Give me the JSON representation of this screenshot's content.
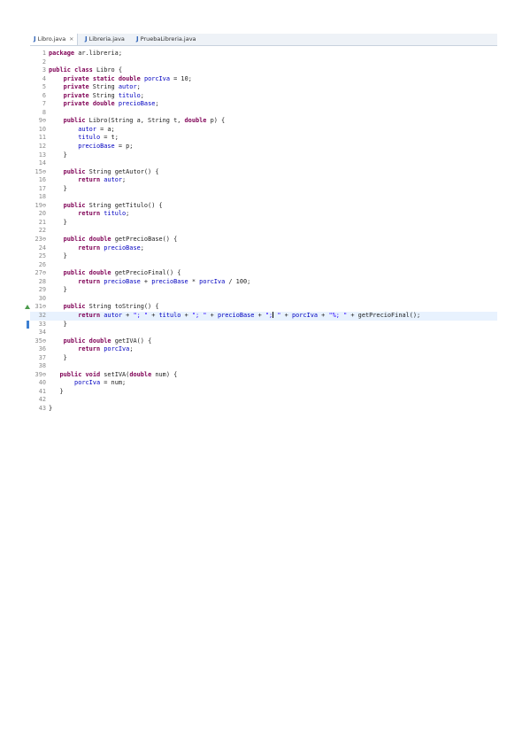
{
  "tabs": [
    {
      "label": "Libro.java",
      "icon": "java-file-icon",
      "active": true
    },
    {
      "label": "Libreria.java",
      "icon": "java-file-icon",
      "active": false
    },
    {
      "label": "PruebaLibreria.java",
      "icon": "java-file-icon",
      "active": false
    }
  ],
  "tab_close": "✕",
  "code": {
    "l1": {
      "num": "1",
      "kw": "package",
      "rest": " ar.libreria;"
    },
    "l2": {
      "num": "2"
    },
    "l3": {
      "num": "3",
      "kw1": "public",
      "kw2": "class",
      "rest": " Libro {"
    },
    "l4": {
      "num": "4",
      "kw1": "private",
      "kw2": "static",
      "kw3": "double",
      "field": "porcIva",
      "rest": " = 10;"
    },
    "l5": {
      "num": "5",
      "kw1": "private",
      "type": " String ",
      "field": "autor",
      "rest": ";"
    },
    "l6": {
      "num": "6",
      "kw1": "private",
      "type": " String ",
      "field": "titulo",
      "rest": ";"
    },
    "l7": {
      "num": "7",
      "kw1": "private",
      "kw2": "double",
      "field": "precioBase",
      "rest": ";"
    },
    "l8": {
      "num": "8"
    },
    "l9": {
      "num": "9⊖",
      "kw1": "public",
      "mid": " Libro(String a, String t, ",
      "kw2": "double",
      "rest": " p) {"
    },
    "l10": {
      "num": "10",
      "field": "autor",
      "rest": " = a;"
    },
    "l11": {
      "num": "11",
      "field": "titulo",
      "rest": " = t;"
    },
    "l12": {
      "num": "12",
      "field": "precioBase",
      "rest": " = p;"
    },
    "l13": {
      "num": "13",
      "rest": "}"
    },
    "l14": {
      "num": "14"
    },
    "l15": {
      "num": "15⊖",
      "kw1": "public",
      "rest": " String getAutor() {"
    },
    "l16": {
      "num": "16",
      "kw1": "return",
      "field": "autor",
      "rest": ";"
    },
    "l17": {
      "num": "17",
      "rest": "}"
    },
    "l18": {
      "num": "18"
    },
    "l19": {
      "num": "19⊖",
      "kw1": "public",
      "rest": " String getTitulo() {"
    },
    "l20": {
      "num": "20",
      "kw1": "return",
      "field": "titulo",
      "rest": ";"
    },
    "l21": {
      "num": "21",
      "rest": "}"
    },
    "l22": {
      "num": "22"
    },
    "l23": {
      "num": "23⊖",
      "kw1": "public",
      "kw2": "double",
      "rest": " getPrecioBase() {"
    },
    "l24": {
      "num": "24",
      "kw1": "return",
      "field": "precioBase",
      "rest": ";"
    },
    "l25": {
      "num": "25",
      "rest": "}"
    },
    "l26": {
      "num": "26"
    },
    "l27": {
      "num": "27⊖",
      "kw1": "public",
      "kw2": "double",
      "rest": " getPrecioFinal() {"
    },
    "l28": {
      "num": "28",
      "kw1": "return",
      "f1": "precioBase",
      "mid": " + ",
      "f2": "precioBase",
      "mid2": " * ",
      "f3": "porcIva",
      "rest": " / 100;"
    },
    "l29": {
      "num": "29",
      "rest": "}"
    },
    "l30": {
      "num": "30"
    },
    "l31": {
      "num": "31⊖",
      "kw1": "public",
      "rest": " String toString() {"
    },
    "l32": {
      "num": "32",
      "kw1": "return",
      "f1": "autor",
      "s1": "\"; \"",
      "f2": "titulo",
      "s2": "\"; \"",
      "f3": "precioBase",
      "s3": "\";",
      "s3b": " \"",
      "f4": "porcIva",
      "s4": "\"%; \"",
      "rest": " + getPrecioFinal();"
    },
    "l33": {
      "num": "33",
      "rest": "}"
    },
    "l34": {
      "num": "34"
    },
    "l35": {
      "num": "35⊖",
      "kw1": "public",
      "kw2": "double",
      "rest": " getIVA() {"
    },
    "l36": {
      "num": "36",
      "kw1": "return",
      "field": "porcIva",
      "rest": ";"
    },
    "l37": {
      "num": "37",
      "rest": "}"
    },
    "l38": {
      "num": "38"
    },
    "l39": {
      "num": "39⊖",
      "kw1": "public",
      "kw2": "void",
      "mid": " setIVA(",
      "kw3": "double",
      "rest": " num) {"
    },
    "l40": {
      "num": "40",
      "field": "porcIva",
      "rest": " = num;"
    },
    "l41": {
      "num": "41",
      "rest": "}"
    },
    "l42": {
      "num": "42"
    },
    "l43": {
      "num": "43",
      "rest": "}"
    }
  }
}
